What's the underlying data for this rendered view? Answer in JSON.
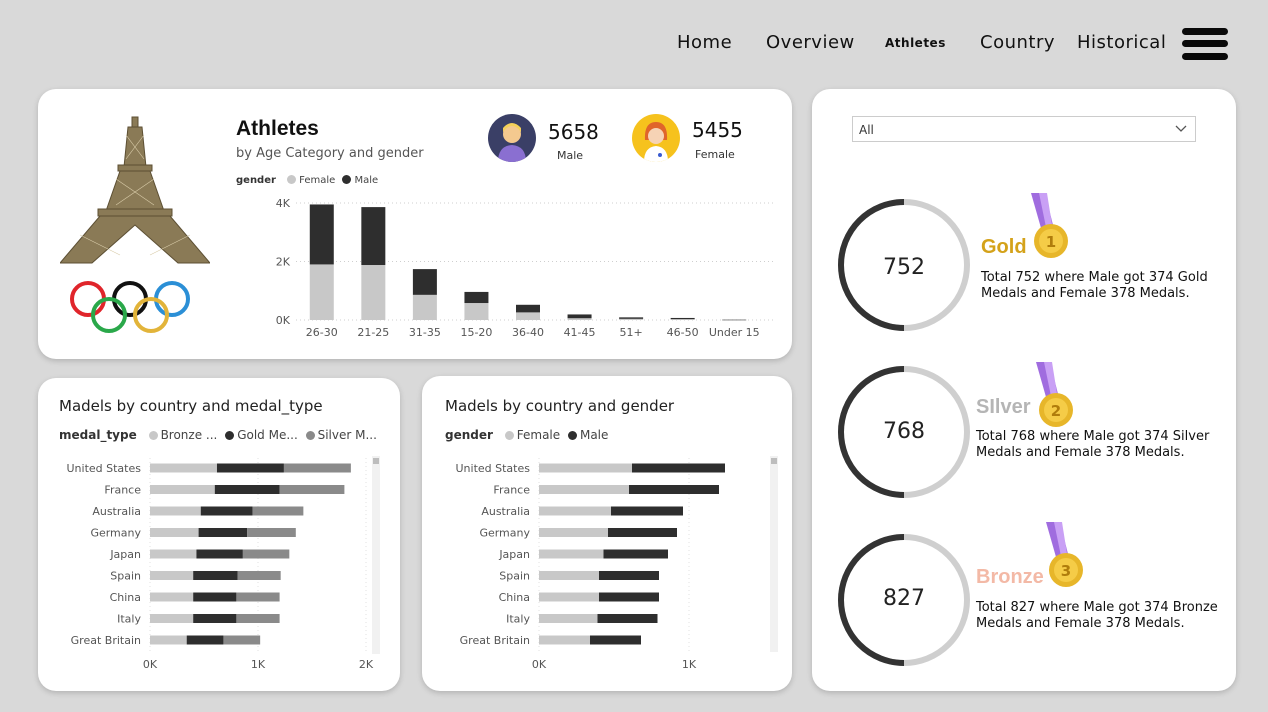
{
  "nav": {
    "items": [
      "Home",
      "Overview",
      "Athletes",
      "Country",
      "Historical"
    ],
    "active": "Athletes"
  },
  "athletes_card": {
    "title": "Athletes",
    "subtitle": "by Age Category and gender",
    "legend_title": "gender",
    "legend": [
      "Female",
      "Male"
    ],
    "male_count": "5658",
    "male_label": "Male",
    "female_count": "5455",
    "female_label": "Female"
  },
  "medal_type_card": {
    "title": "Madels by country and medal_type",
    "legend_title": "medal_type",
    "legend": [
      "Bronze ...",
      "Gold Me...",
      "Silver M..."
    ]
  },
  "gender_card": {
    "title": "Madels by country and gender",
    "legend_title": "gender",
    "legend": [
      "Female",
      "Male"
    ]
  },
  "filter": {
    "value": "All"
  },
  "medals": [
    {
      "name": "Gold",
      "total": "752",
      "description": "Total 752 where Male got 374 Gold Medals and Female 378 Medals.",
      "color": "#d4a21a",
      "ring_fraction": 0.5
    },
    {
      "name": "Silver",
      "display_name": "SIlver",
      "total": "768",
      "description": "Total 768 where Male got 374 Silver Medals and Female 378 Medals.",
      "color": "#b5b5b5",
      "ring_fraction": 0.5
    },
    {
      "name": "Bronze",
      "total": "827",
      "description": "Total 827 where Male got 374 Bronze Medals and Female 378 Medals.",
      "color": "#f3b9a6",
      "ring_fraction": 0.5
    }
  ],
  "colors": {
    "female": "#c8c8c8",
    "male": "#2e2e2e",
    "bronze": "#c8c8c8",
    "gold": "#2e2e2e",
    "silver": "#8a8a8a"
  },
  "chart_data": [
    {
      "type": "bar",
      "stacked": true,
      "title": "Athletes",
      "categories": [
        "26-30",
        "21-25",
        "31-35",
        "15-20",
        "36-40",
        "41-45",
        "51+",
        "46-50",
        "Under 15"
      ],
      "series": [
        {
          "name": "Female",
          "values": [
            1900,
            1880,
            860,
            580,
            260,
            60,
            40,
            30,
            5
          ]
        },
        {
          "name": "Male",
          "values": [
            2050,
            1980,
            880,
            380,
            260,
            130,
            50,
            40,
            5
          ]
        }
      ],
      "yticks": [
        "0K",
        "2K",
        "4K"
      ],
      "ylim": [
        0,
        4000
      ]
    },
    {
      "type": "bar",
      "orientation": "horizontal",
      "stacked": true,
      "title": "Madels by country and medal_type",
      "categories": [
        "United States",
        "France",
        "Australia",
        "Germany",
        "Japan",
        "Spain",
        "China",
        "Italy",
        "Great Britain"
      ],
      "series": [
        {
          "name": "Bronze ...",
          "values": [
            620,
            600,
            470,
            450,
            430,
            400,
            400,
            400,
            340
          ]
        },
        {
          "name": "Gold Me...",
          "values": [
            620,
            600,
            480,
            450,
            430,
            410,
            400,
            400,
            340
          ]
        },
        {
          "name": "Silver M...",
          "values": [
            620,
            600,
            470,
            450,
            430,
            400,
            400,
            400,
            340
          ]
        }
      ],
      "xticks": [
        "0K",
        "1K",
        "2K"
      ],
      "xlim": [
        0,
        2000
      ]
    },
    {
      "type": "bar",
      "orientation": "horizontal",
      "stacked": true,
      "title": "Madels by country and gender",
      "categories": [
        "United States",
        "France",
        "Australia",
        "Germany",
        "Japan",
        "Spain",
        "China",
        "Italy",
        "Great Britain"
      ],
      "series": [
        {
          "name": "Female",
          "values": [
            620,
            600,
            480,
            460,
            430,
            400,
            400,
            390,
            340
          ]
        },
        {
          "name": "Male",
          "values": [
            620,
            600,
            480,
            460,
            430,
            400,
            400,
            400,
            340
          ]
        }
      ],
      "xticks": [
        "0K",
        "1K"
      ],
      "xlim": [
        0,
        1000
      ]
    }
  ]
}
